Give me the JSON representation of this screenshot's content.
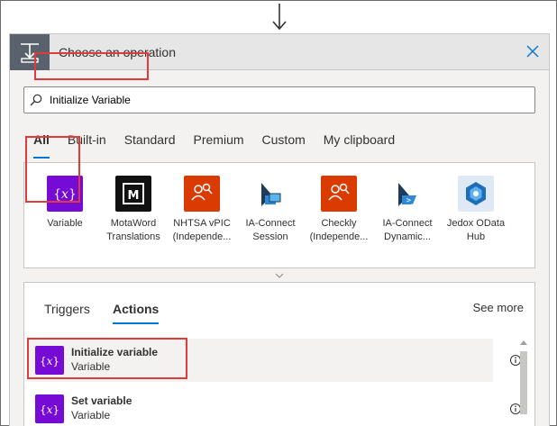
{
  "header": {
    "title": "Choose an operation"
  },
  "search": {
    "value": "Initialize Variable"
  },
  "tabs": [
    {
      "label": "All",
      "active": true
    },
    {
      "label": "Built-in"
    },
    {
      "label": "Standard"
    },
    {
      "label": "Premium"
    },
    {
      "label": "Custom"
    },
    {
      "label": "My clipboard"
    }
  ],
  "connectors": [
    {
      "line1": "Variable",
      "line2": "",
      "icon": "variable-braces-icon",
      "color": "#770bd6"
    },
    {
      "line1": "MotaWord",
      "line2": "Translations",
      "icon": "motaword-m-icon",
      "color": "#111111"
    },
    {
      "line1": "NHTSA vPIC",
      "line2": "(Independe...",
      "icon": "people-search-icon",
      "color": "#da3b01"
    },
    {
      "line1": "IA-Connect",
      "line2": "Session",
      "icon": "ia-connect-icon",
      "color": "#ffffff"
    },
    {
      "line1": "Checkly",
      "line2": "(Independe...",
      "icon": "people-search-icon",
      "color": "#da3b01"
    },
    {
      "line1": "IA-Connect",
      "line2": "Dynamic...",
      "icon": "ia-connect-icon",
      "color": "#ffffff"
    },
    {
      "line1": "Jedox OData",
      "line2": "Hub",
      "icon": "jedox-hexagon-icon",
      "color": "#dfe9f5"
    }
  ],
  "results": {
    "tabs": [
      {
        "label": "Triggers"
      },
      {
        "label": "Actions",
        "active": true
      }
    ],
    "see_more": "See more",
    "actions": [
      {
        "title": "Initialize variable",
        "subtitle": "Variable",
        "selected": true
      },
      {
        "title": "Set variable",
        "subtitle": "Variable"
      }
    ]
  },
  "colors": {
    "variable_purple": "#770bd6",
    "accent_blue": "#0078d4",
    "highlight_red": "#e03a3a"
  }
}
